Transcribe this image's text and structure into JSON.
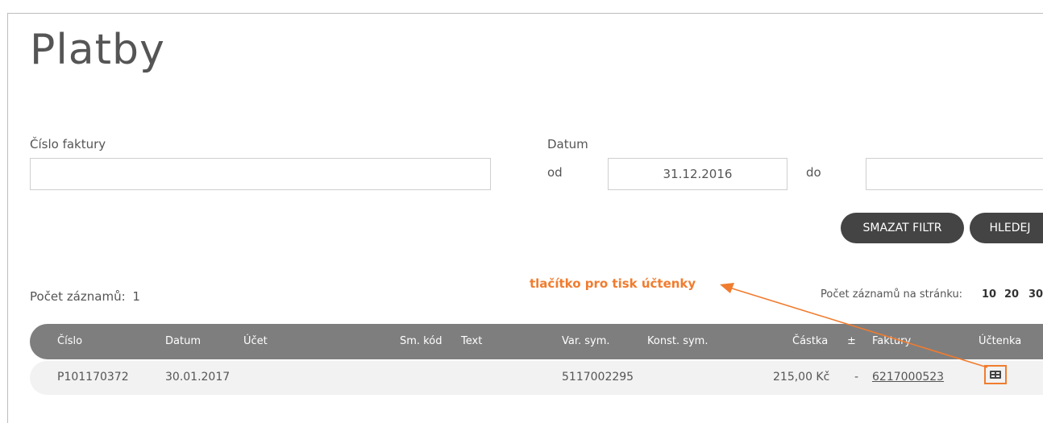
{
  "page": {
    "title": "Platby"
  },
  "filter": {
    "invoice_label": "Číslo faktury",
    "invoice_value": "",
    "date_label": "Datum",
    "from_label": "od",
    "from_value": "31.12.2016",
    "to_label": "do",
    "to_value": "",
    "clear_button": "SMAZAT FILTR",
    "search_button": "HLEDEJ"
  },
  "annotation": {
    "text": "tlačítko pro tisk účtenky",
    "color": "#f07c2f"
  },
  "records": {
    "count_label": "Počet záznamů:",
    "count_value": "1",
    "per_page_label": "Počet záznamů na stránku:",
    "per_page_options": [
      "10",
      "20",
      "30"
    ]
  },
  "table": {
    "headers": {
      "cislo": "Číslo",
      "datum": "Datum",
      "ucet": "Účet",
      "sm_kod": "Sm. kód",
      "text": "Text",
      "var_sym": "Var. sym.",
      "konst_sym": "Konst. sym.",
      "castka": "Částka",
      "plusminus": "±",
      "faktury": "Faktury",
      "uctenka": "Účtenka"
    },
    "rows": [
      {
        "cislo": "P101170372",
        "datum": "30.01.2017",
        "ucet": "",
        "sm_kod": "",
        "text": "",
        "var_sym": "5117002295",
        "konst_sym": "",
        "castka": "215,00 Kč",
        "plusminus": "-",
        "faktury": "6217000523",
        "uctenka_icon": "receipt-print-icon"
      }
    ]
  },
  "colors": {
    "header_bg": "#7e7e7e",
    "row_bg": "#f2f2f2",
    "button_bg": "#444444",
    "accent": "#f07c2f"
  }
}
